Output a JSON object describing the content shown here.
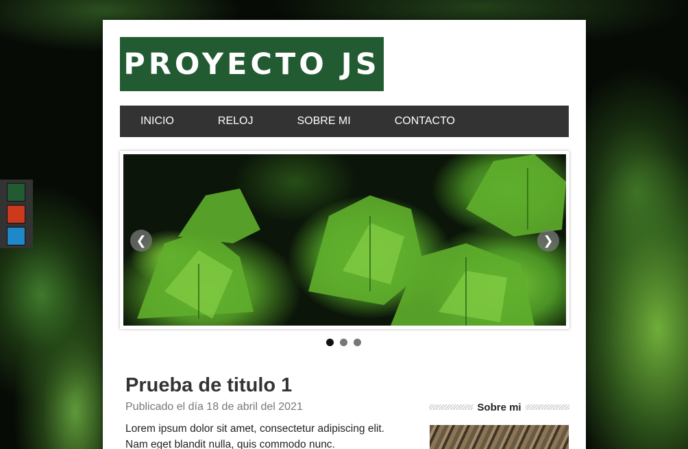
{
  "theme_colors": [
    "#225b32",
    "#cc3a1c",
    "#1e88c8"
  ],
  "logo": {
    "text": "PROYECTO JS"
  },
  "menu": {
    "items": [
      "INICIO",
      "RELOJ",
      "SOBRE MI",
      "CONTACTO"
    ]
  },
  "slider": {
    "prev_icon": "chevron-left-icon",
    "next_icon": "chevron-right-icon",
    "slide_count": 3,
    "active_slide": 1
  },
  "post": {
    "title": "Prueba de titulo 1",
    "date": "Publicado el día 18 de abril del 2021",
    "body": "Lorem ipsum dolor sit amet, consectetur adipiscing elit. Nam eget blandit nulla, quis commodo nunc."
  },
  "sidebar": {
    "heading": "Sobre mi"
  }
}
